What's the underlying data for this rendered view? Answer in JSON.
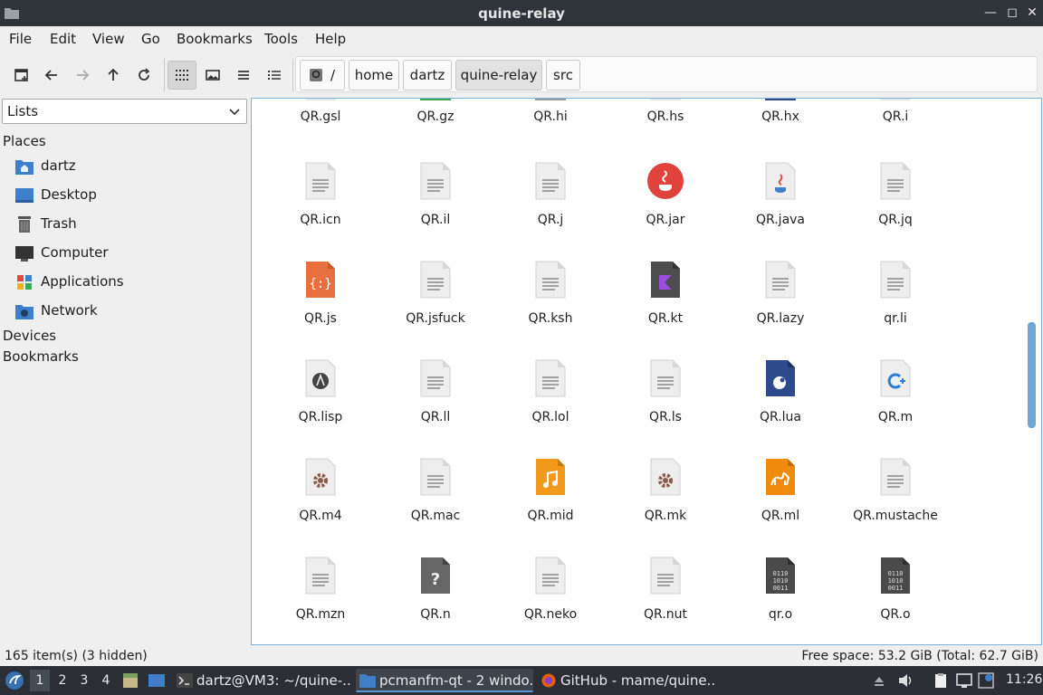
{
  "window": {
    "title": "quine-relay"
  },
  "menu": [
    "File",
    "Edit",
    "View",
    "Go",
    "Bookmarks",
    "Tools",
    "Help"
  ],
  "path": {
    "root": "/",
    "crumbs": [
      "home",
      "dartz",
      "quine-relay",
      "src"
    ]
  },
  "sidebar": {
    "selector": "Lists",
    "places_header": "Places",
    "places": [
      {
        "label": "dartz",
        "icon": "home-folder-icon"
      },
      {
        "label": "Desktop",
        "icon": "desktop-icon"
      },
      {
        "label": "Trash",
        "icon": "trash-icon"
      },
      {
        "label": "Computer",
        "icon": "computer-icon"
      },
      {
        "label": "Applications",
        "icon": "applications-icon"
      },
      {
        "label": "Network",
        "icon": "network-icon"
      }
    ],
    "devices_header": "Devices",
    "bookmarks_header": "Bookmarks"
  },
  "files": {
    "partial_row": [
      "QR.gsl",
      "QR.gz",
      "QR.hi",
      "QR.hs",
      "QR.hx",
      "QR.i"
    ],
    "rows": [
      [
        {
          "name": "QR.icn",
          "icon": "text"
        },
        {
          "name": "QR.il",
          "icon": "text"
        },
        {
          "name": "QR.j",
          "icon": "text"
        },
        {
          "name": "QR.jar",
          "icon": "jar"
        },
        {
          "name": "QR.java",
          "icon": "java"
        },
        {
          "name": "QR.jq",
          "icon": "text"
        }
      ],
      [
        {
          "name": "QR.js",
          "icon": "js"
        },
        {
          "name": "QR.jsfuck",
          "icon": "text"
        },
        {
          "name": "QR.ksh",
          "icon": "text"
        },
        {
          "name": "QR.kt",
          "icon": "kotlin"
        },
        {
          "name": "QR.lazy",
          "icon": "text"
        },
        {
          "name": "qr.li",
          "icon": "text"
        }
      ],
      [
        {
          "name": "QR.lisp",
          "icon": "lisp"
        },
        {
          "name": "QR.ll",
          "icon": "text"
        },
        {
          "name": "QR.lol",
          "icon": "text"
        },
        {
          "name": "QR.ls",
          "icon": "text"
        },
        {
          "name": "QR.lua",
          "icon": "lua"
        },
        {
          "name": "QR.m",
          "icon": "cpp"
        }
      ],
      [
        {
          "name": "QR.m4",
          "icon": "gear"
        },
        {
          "name": "QR.mac",
          "icon": "text"
        },
        {
          "name": "QR.mid",
          "icon": "audio"
        },
        {
          "name": "QR.mk",
          "icon": "gear"
        },
        {
          "name": "QR.ml",
          "icon": "ocaml"
        },
        {
          "name": "QR.mustache",
          "icon": "text"
        }
      ],
      [
        {
          "name": "QR.mzn",
          "icon": "text"
        },
        {
          "name": "QR.n",
          "icon": "unknown"
        },
        {
          "name": "QR.neko",
          "icon": "text"
        },
        {
          "name": "QR.nut",
          "icon": "text"
        },
        {
          "name": "qr.o",
          "icon": "binary"
        },
        {
          "name": "QR.o",
          "icon": "binary"
        }
      ]
    ]
  },
  "status": {
    "left": "165 item(s) (3 hidden)",
    "right": "Free space: 53.2 GiB (Total: 62.7 GiB)"
  },
  "taskbar": {
    "workspaces": [
      "1",
      "2",
      "3",
      "4"
    ],
    "tasks": [
      "dartz@VM3: ~/quine-...",
      "pcmanfm-qt - 2 windo...",
      "GitHub - mame/quine..."
    ],
    "clock": "11:26"
  },
  "colors": {
    "accent": "#5a96d6",
    "titlebar": "#2f343a",
    "taskbar": "#2b2f35"
  }
}
